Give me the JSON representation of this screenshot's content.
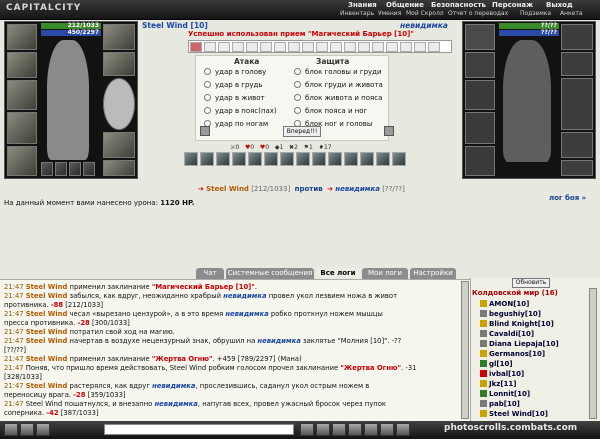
{
  "app": {
    "title": "CAPITALCITY"
  },
  "topmenu": {
    "main": [
      "Знания",
      "Общение",
      "Безопасность",
      "Персонаж",
      "Выход"
    ],
    "sub": [
      "Инвентарь",
      "Умения",
      "Мой Скролл",
      "Отчет о переводах",
      "Подземка",
      "Анкета"
    ]
  },
  "player": {
    "name": "Steel Wind",
    "level": "[10]",
    "hp": "212/1033",
    "mana": "450/2297"
  },
  "enemy": {
    "name": "невидимка",
    "hp": "??/??",
    "mana": "??/??"
  },
  "message": "Успешно использован прием \"Магический Барьер [10]\"",
  "fight": {
    "attack_header": "Атака",
    "defense_header": "Защита",
    "attacks": [
      "удар в голову",
      "удар в грудь",
      "удар в живот",
      "удар в пояс(пах)",
      "удар по ногам"
    ],
    "defenses": [
      "блок головы и груди",
      "блок груди и живота",
      "блок живота и пояса",
      "блок пояса и ног",
      "блок ног и головы"
    ],
    "go_button": "Вперед!!!"
  },
  "counters": [
    "0",
    "0",
    "0",
    "1",
    "2",
    "1",
    "17"
  ],
  "versus": {
    "player": "Steel Wind",
    "player_hp": "[212/1033]",
    "word": "против",
    "enemy": "невидимка",
    "enemy_hp": "[??/??]"
  },
  "damage": {
    "label": "На данный момент вами нанесено урона:",
    "value": "1120 HP."
  },
  "fight_log_link": "лог боя »",
  "tabs": [
    "Чат",
    "Системные сообщения",
    "Все логи",
    "Мои логи",
    "Настройки"
  ],
  "chat_lines": [
    {
      "t": "21:47",
      "a": "Steel Wind",
      "b": " применил заклинание ",
      "c": "\"Магический Барьер [10]\"",
      "d": "."
    },
    {
      "t": "21:47",
      "a": "Steel Wind",
      "b": " забылся, как вдруг, неожиданно храбрый ",
      "c": "невидимка",
      "d": " провел укол лезвием ножа в живот"
    },
    {
      "t": "",
      "a": "",
      "b": "противника. ",
      "c": "-88",
      "d": " [212/1033]"
    },
    {
      "t": "21:47",
      "a": "Steel Wind",
      "b": " чесал «вырезано цензурой», а в это время ",
      "c": "невидимка",
      "d": " робко проткнул ножем мышцы"
    },
    {
      "t": "",
      "a": "",
      "b": "пресса противника. ",
      "c": "-28",
      "d": " [300/1033]"
    },
    {
      "t": "21:47",
      "a": "Steel Wind",
      "b": " потратил свой ход на магию.",
      "c": "",
      "d": ""
    },
    {
      "t": "21:47",
      "a": "Steel Wind",
      "b": " начертав в воздухе нецензурный знак, обрушил на ",
      "c": "невидимка",
      "d": " заклятье \"Молния [10]\". -??"
    },
    {
      "t": "",
      "a": "",
      "b": "[??/??]",
      "c": "",
      "d": ""
    },
    {
      "t": "21:47",
      "a": "Steel Wind",
      "b": " применил заклинание ",
      "c": "\"Жертва Огню\"",
      "d": ". +459 [789/2297] (Мана)"
    },
    {
      "t": "21:47",
      "a": "",
      "b": "Поняв, что пришло время действовать, Steel Wind робким голосом прочел заклинание ",
      "c": "\"Жертва Огню\"",
      "d": ". -31"
    },
    {
      "t": "",
      "a": "",
      "b": "[328/1033]",
      "c": "",
      "d": ""
    },
    {
      "t": "21:47",
      "a": "Steel Wind",
      "b": " растерялся, как вдруг ",
      "c": "невидимка",
      "d": ", прослезившись, саданул укол острым ножем в"
    },
    {
      "t": "",
      "a": "",
      "b": "переносицу врага. ",
      "c": "-28",
      "d": " [359/1033]"
    },
    {
      "t": "21:47",
      "a": "",
      "b": "Steel Wind пошатнулся, и внезапно ",
      "c": "невидимка",
      "d": ", напугав всех, провел ужасный бросок через пупок"
    },
    {
      "t": "",
      "a": "",
      "b": "соперника. ",
      "c": "-42",
      "d": " [387/1033]"
    }
  ],
  "room": {
    "refresh": "Обновить",
    "title": "Колдовской мир (16)",
    "users": [
      "AMON[10]",
      "begushiy[10]",
      "Blind Knight[10]",
      "Cavaldi[10]",
      "Diana Liepaja[10]",
      "Germanos[10]",
      "gl[10]",
      "ivbal[10]",
      "Jkz[11]",
      "Lonnit[10]",
      "pab[10]",
      "Steel Wind[10]"
    ]
  },
  "watermark": "photoscrolls.combats.com"
}
